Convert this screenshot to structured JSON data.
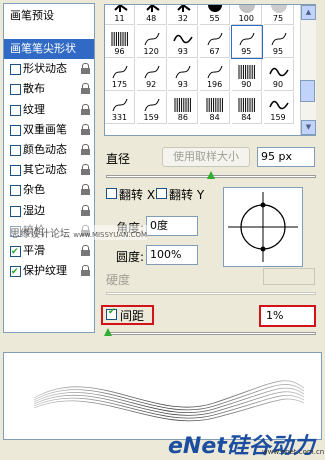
{
  "left_panel": {
    "header": "画笔预设",
    "items": [
      {
        "label": "画笔笔尖形状",
        "checkbox": false,
        "checked": false,
        "lock": false,
        "selected": true
      },
      {
        "label": "形状动态",
        "checkbox": true,
        "checked": false,
        "lock": true
      },
      {
        "label": "散布",
        "checkbox": true,
        "checked": false,
        "lock": true
      },
      {
        "label": "纹理",
        "checkbox": true,
        "checked": false,
        "lock": true
      },
      {
        "label": "双重画笔",
        "checkbox": true,
        "checked": false,
        "lock": true
      },
      {
        "label": "颜色动态",
        "checkbox": true,
        "checked": false,
        "lock": true
      },
      {
        "label": "其它动态",
        "checkbox": true,
        "checked": false,
        "lock": true
      },
      {
        "label": "杂色",
        "checkbox": true,
        "checked": false,
        "lock": true
      },
      {
        "label": "湿边",
        "checkbox": true,
        "checked": false,
        "lock": true
      },
      {
        "label": "喷枪",
        "checkbox": true,
        "checked": false,
        "lock": true
      },
      {
        "label": "平滑",
        "checkbox": true,
        "checked": true,
        "lock": true
      },
      {
        "label": "保护纹理",
        "checkbox": true,
        "checked": true,
        "lock": true
      }
    ]
  },
  "brush_grid": {
    "rows": [
      [
        "11",
        "48",
        "32",
        "55",
        "100",
        "75"
      ],
      [
        "96",
        "120",
        "93",
        "67",
        "95",
        "95"
      ],
      [
        "175",
        "92",
        "93",
        "196",
        "90",
        "90"
      ],
      [
        "331",
        "159",
        "86",
        "84",
        "84",
        "159"
      ]
    ],
    "selected": [
      1,
      4
    ]
  },
  "diameter": {
    "label": "直径",
    "button": "使用取样大小",
    "value": "95 px",
    "slider_fraction": 0.5
  },
  "flip": {
    "x_label": "翻转 X",
    "y_label": "翻转 Y"
  },
  "angle": {
    "label": "角度:",
    "value": "0度"
  },
  "roundness": {
    "label": "圆度:",
    "value": "100%"
  },
  "hardness": {
    "label": "硬度"
  },
  "spacing": {
    "label": "间距",
    "checked": true,
    "value": "1%",
    "slider_fraction": 0.01
  },
  "watermarks": {
    "left": "思缘设计论坛",
    "left_url": "www.MISSYUAN.COM",
    "logo": "eNet硅谷动力",
    "logo_url": "www.enet.com.cn"
  },
  "colors": {
    "accent_red": "#d0141a",
    "panel_bg": "#ece9d8",
    "selection": "#316ac5",
    "border": "#7f9db9",
    "knob": "#2fae2f"
  }
}
